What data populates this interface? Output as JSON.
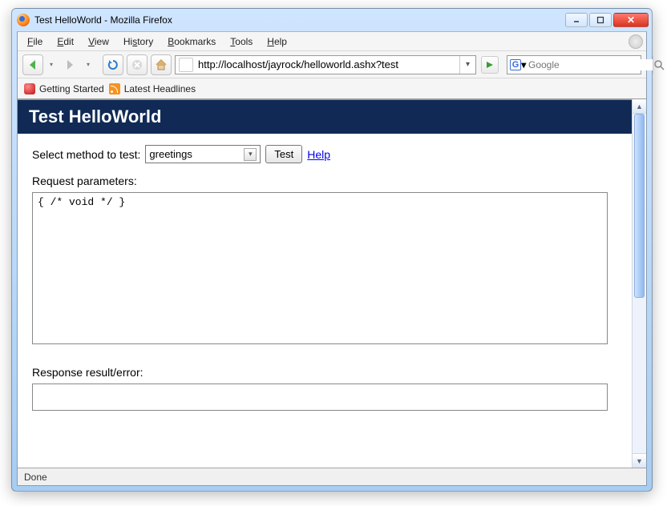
{
  "window": {
    "title": "Test HelloWorld - Mozilla Firefox"
  },
  "menu": {
    "file": "File",
    "edit": "Edit",
    "view": "View",
    "history": "History",
    "bookmarks": "Bookmarks",
    "tools": "Tools",
    "help": "Help"
  },
  "toolbar": {
    "url": "http://localhost/jayrock/helloworld.ashx?test",
    "search_engine": "G",
    "search_placeholder": "Google"
  },
  "bookmarks": {
    "getting_started": "Getting Started",
    "latest_headlines": "Latest Headlines"
  },
  "page": {
    "heading": "Test HelloWorld",
    "select_label": "Select method to test:",
    "method_selected": "greetings",
    "test_button": "Test",
    "help_link": "Help",
    "request_label": "Request parameters:",
    "request_value": "{ /* void */ }",
    "response_label": "Response result/error:",
    "response_value": ""
  },
  "status": {
    "text": "Done"
  }
}
